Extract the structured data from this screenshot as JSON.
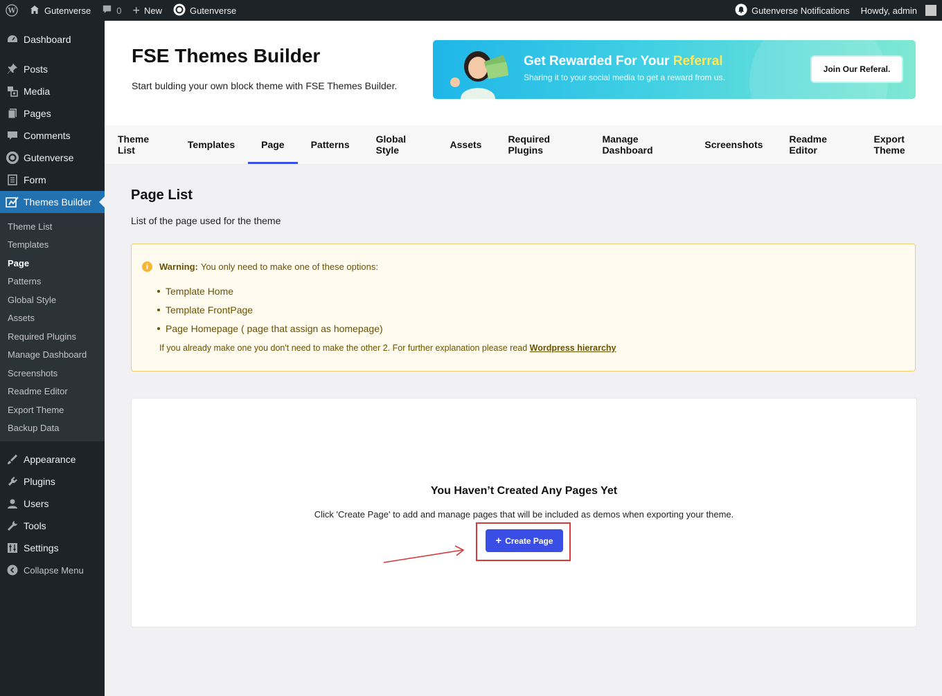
{
  "adminbar": {
    "site_name": "Gutenverse",
    "comments_count": "0",
    "new_label": "New",
    "plugin_label": "Gutenverse",
    "notifications_label": "Gutenverse Notifications",
    "howdy_label": "Howdy, admin"
  },
  "sidebar": {
    "top_items": [
      {
        "label": "Dashboard",
        "icon": "dashboard-icon"
      }
    ],
    "items": [
      {
        "label": "Posts",
        "icon": "pin-icon"
      },
      {
        "label": "Media",
        "icon": "media-icon"
      },
      {
        "label": "Pages",
        "icon": "pages-icon"
      },
      {
        "label": "Comments",
        "icon": "comment-icon"
      },
      {
        "label": "Gutenverse",
        "icon": "gutenverse-icon"
      },
      {
        "label": "Form",
        "icon": "form-icon"
      },
      {
        "label": "Themes Builder",
        "icon": "themes-builder-icon"
      }
    ],
    "submenu": [
      "Theme List",
      "Templates",
      "Page",
      "Patterns",
      "Global Style",
      "Assets",
      "Required Plugins",
      "Manage Dashboard",
      "Screenshots",
      "Readme Editor",
      "Export Theme",
      "Backup Data"
    ],
    "bottom_items": [
      {
        "label": "Appearance",
        "icon": "appearance-icon"
      },
      {
        "label": "Plugins",
        "icon": "plugins-icon"
      },
      {
        "label": "Users",
        "icon": "users-icon"
      },
      {
        "label": "Tools",
        "icon": "tools-icon"
      },
      {
        "label": "Settings",
        "icon": "settings-icon"
      }
    ],
    "collapse_label": "Collapse Menu"
  },
  "header": {
    "title": "FSE Themes Builder",
    "subtitle": "Start bulding your own block theme with FSE Themes Builder."
  },
  "banner": {
    "title_prefix": "Get Rewarded For Your ",
    "title_highlight": "Referral",
    "subtitle": "Sharing it to your social media to get a reward from us.",
    "button_label": "Join Our Referal."
  },
  "tabs": [
    "Theme List",
    "Templates",
    "Page",
    "Patterns",
    "Global Style",
    "Assets",
    "Required Plugins",
    "Manage Dashboard",
    "Screenshots",
    "Readme Editor",
    "Export Theme"
  ],
  "content": {
    "title": "Page List",
    "subtitle": "List of the page used for the theme"
  },
  "warning": {
    "label": "Warning:",
    "text": "You only need to make one of these options:",
    "options": [
      "Template Home",
      "Template FrontPage",
      "Page Homepage ( page that assign as homepage)"
    ],
    "footer_text": "If you already make one you don't need to make the other 2. For further explanation please read ",
    "footer_link": "Wordpress hierarchy"
  },
  "empty_state": {
    "title": "You Haven’t Created Any Pages Yet",
    "description": "Click 'Create Page' to add and manage pages that will be included as demos when exporting your theme.",
    "button_label": "Create Page"
  },
  "colors": {
    "wp_dark": "#1d2327",
    "wp_blue": "#2271b1",
    "accent": "#3a4ee6",
    "warning_border": "#f0cf6c",
    "annotation_red": "#d63a3a"
  }
}
